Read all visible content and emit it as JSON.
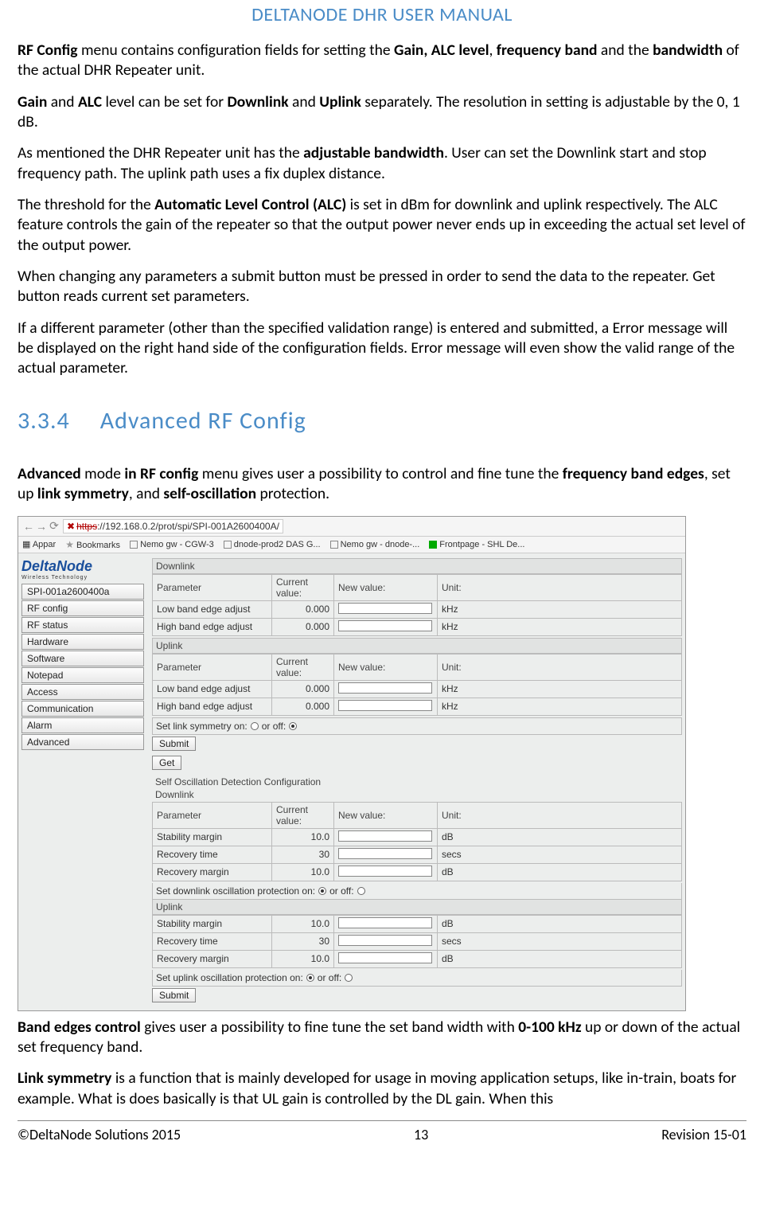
{
  "header": {
    "title": "DELTANODE DHR USER MANUAL"
  },
  "paragraphs": {
    "p1a": "RF Config",
    "p1b": " menu contains configuration fields for setting the ",
    "p1c": "Gain, ALC level",
    "p1d": ", ",
    "p1e": "frequency band",
    "p1f": " and the ",
    "p1g": "bandwidth",
    "p1h": " of the actual DHR Repeater unit.",
    "p2a": "Gain",
    "p2b": " and ",
    "p2c": "ALC",
    "p2d": " level can be set for ",
    "p2e": "Downlink",
    "p2f": " and ",
    "p2g": "Uplink",
    "p2h": " separately. The resolution in setting is adjustable by the 0, 1 dB.",
    "p3a": "As mentioned the DHR Repeater unit has the ",
    "p3b": "adjustable bandwidth",
    "p3c": ". User can set the Downlink start and stop frequency path. The uplink path uses a fix duplex distance.",
    "p4a": "The threshold for the ",
    "p4b": "Automatic Level Control (ALC)",
    "p4c": " is set in dBm for downlink and uplink respectively. The ALC feature controls the gain of the repeater so that the output power never ends up in exceeding the actual set level of the output power.",
    "p5": "When changing any parameters a submit button must be pressed in order to send the data to the repeater. Get button reads current set parameters.",
    "p6": "If a different parameter (other than the specified validation range) is entered and submitted, a Error message will be displayed on the right hand side of the configuration fields. Error message will even show the valid range of the actual parameter.",
    "p7a": "Advanced",
    "p7b": " mode ",
    "p7c": "in RF config",
    "p7d": " menu gives user a possibility to control and fine tune the ",
    "p7e": "frequency band edges",
    "p7f": ", set up ",
    "p7g": "link symmetry",
    "p7h": ", and ",
    "p7i": "self-oscillation",
    "p7j": " protection.",
    "p8a": "Band edges control",
    "p8b": " gives user a possibility to fine tune the set band width with ",
    "p8c": "0-100 kHz",
    "p8d": " up or down of the actual set frequency band.",
    "p9a": "Link symmetry",
    "p9b": " is a function that is mainly developed for usage in moving application setups, like in-train, boats for example. What is does basically is that UL gain is controlled by the DL gain. When this"
  },
  "section": {
    "num": "3.3.4",
    "title": "Advanced RF Config"
  },
  "screenshot": {
    "url_strike": "https",
    "url_rest": "://192.168.0.2/prot/spi/SPI-001A2600400A/",
    "bookmarks": {
      "b1": "Appar",
      "b2": "Bookmarks",
      "b3": "Nemo gw - CGW-3",
      "b4": "dnode-prod2 DAS G...",
      "b5": "Nemo gw - dnode-...",
      "b6": "Frontpage - SHL De..."
    },
    "logo": {
      "brand": "DeltaNode",
      "sub": "Wireless   Technology"
    },
    "leftnav": [
      "SPI-001a2600400a",
      "RF config",
      "RF status",
      "Hardware",
      "Software",
      "Notepad",
      "Access",
      "Communication",
      "Alarm",
      "Advanced"
    ],
    "cols": {
      "param": "Parameter",
      "cur": "Current value:",
      "nv": "New value:",
      "unit": "Unit:"
    },
    "groups": {
      "dl_header": "Downlink",
      "ul_header": "Uplink",
      "dl": [
        {
          "p": "Low band edge adjust",
          "v": "0.000",
          "u": "kHz"
        },
        {
          "p": "High band edge adjust",
          "v": "0.000",
          "u": "kHz"
        }
      ],
      "ul": [
        {
          "p": "Low band edge adjust",
          "v": "0.000",
          "u": "kHz"
        },
        {
          "p": "High band edge adjust",
          "v": "0.000",
          "u": "kHz"
        }
      ],
      "linksym": {
        "label_on": "Set link symmetry on:",
        "label_off": " or off:"
      },
      "btn_submit": "Submit",
      "btn_get": "Get",
      "sod_title": "Self Oscillation Detection Configuration",
      "sod_dl_header": "Downlink",
      "sod_dl": [
        {
          "p": "Stability margin",
          "v": "10.0",
          "u": "dB"
        },
        {
          "p": "Recovery time",
          "v": "30",
          "u": "secs"
        },
        {
          "p": "Recovery margin",
          "v": "10.0",
          "u": "dB"
        }
      ],
      "sod_dl_toggle_on": "Set downlink oscillation protection on:",
      "sod_dl_toggle_off": " or off:",
      "sod_ul_header": "Uplink",
      "sod_ul": [
        {
          "p": "Stability margin",
          "v": "10.0",
          "u": "dB"
        },
        {
          "p": "Recovery time",
          "v": "30",
          "u": "secs"
        },
        {
          "p": "Recovery margin",
          "v": "10.0",
          "u": "dB"
        }
      ],
      "sod_ul_toggle_on": "Set uplink oscillation protection on:",
      "sod_ul_toggle_off": " or off:",
      "btn_submit2": "Submit"
    }
  },
  "footer": {
    "left": "©DeltaNode Solutions 2015",
    "center": "13",
    "right": "Revision 15-01"
  }
}
